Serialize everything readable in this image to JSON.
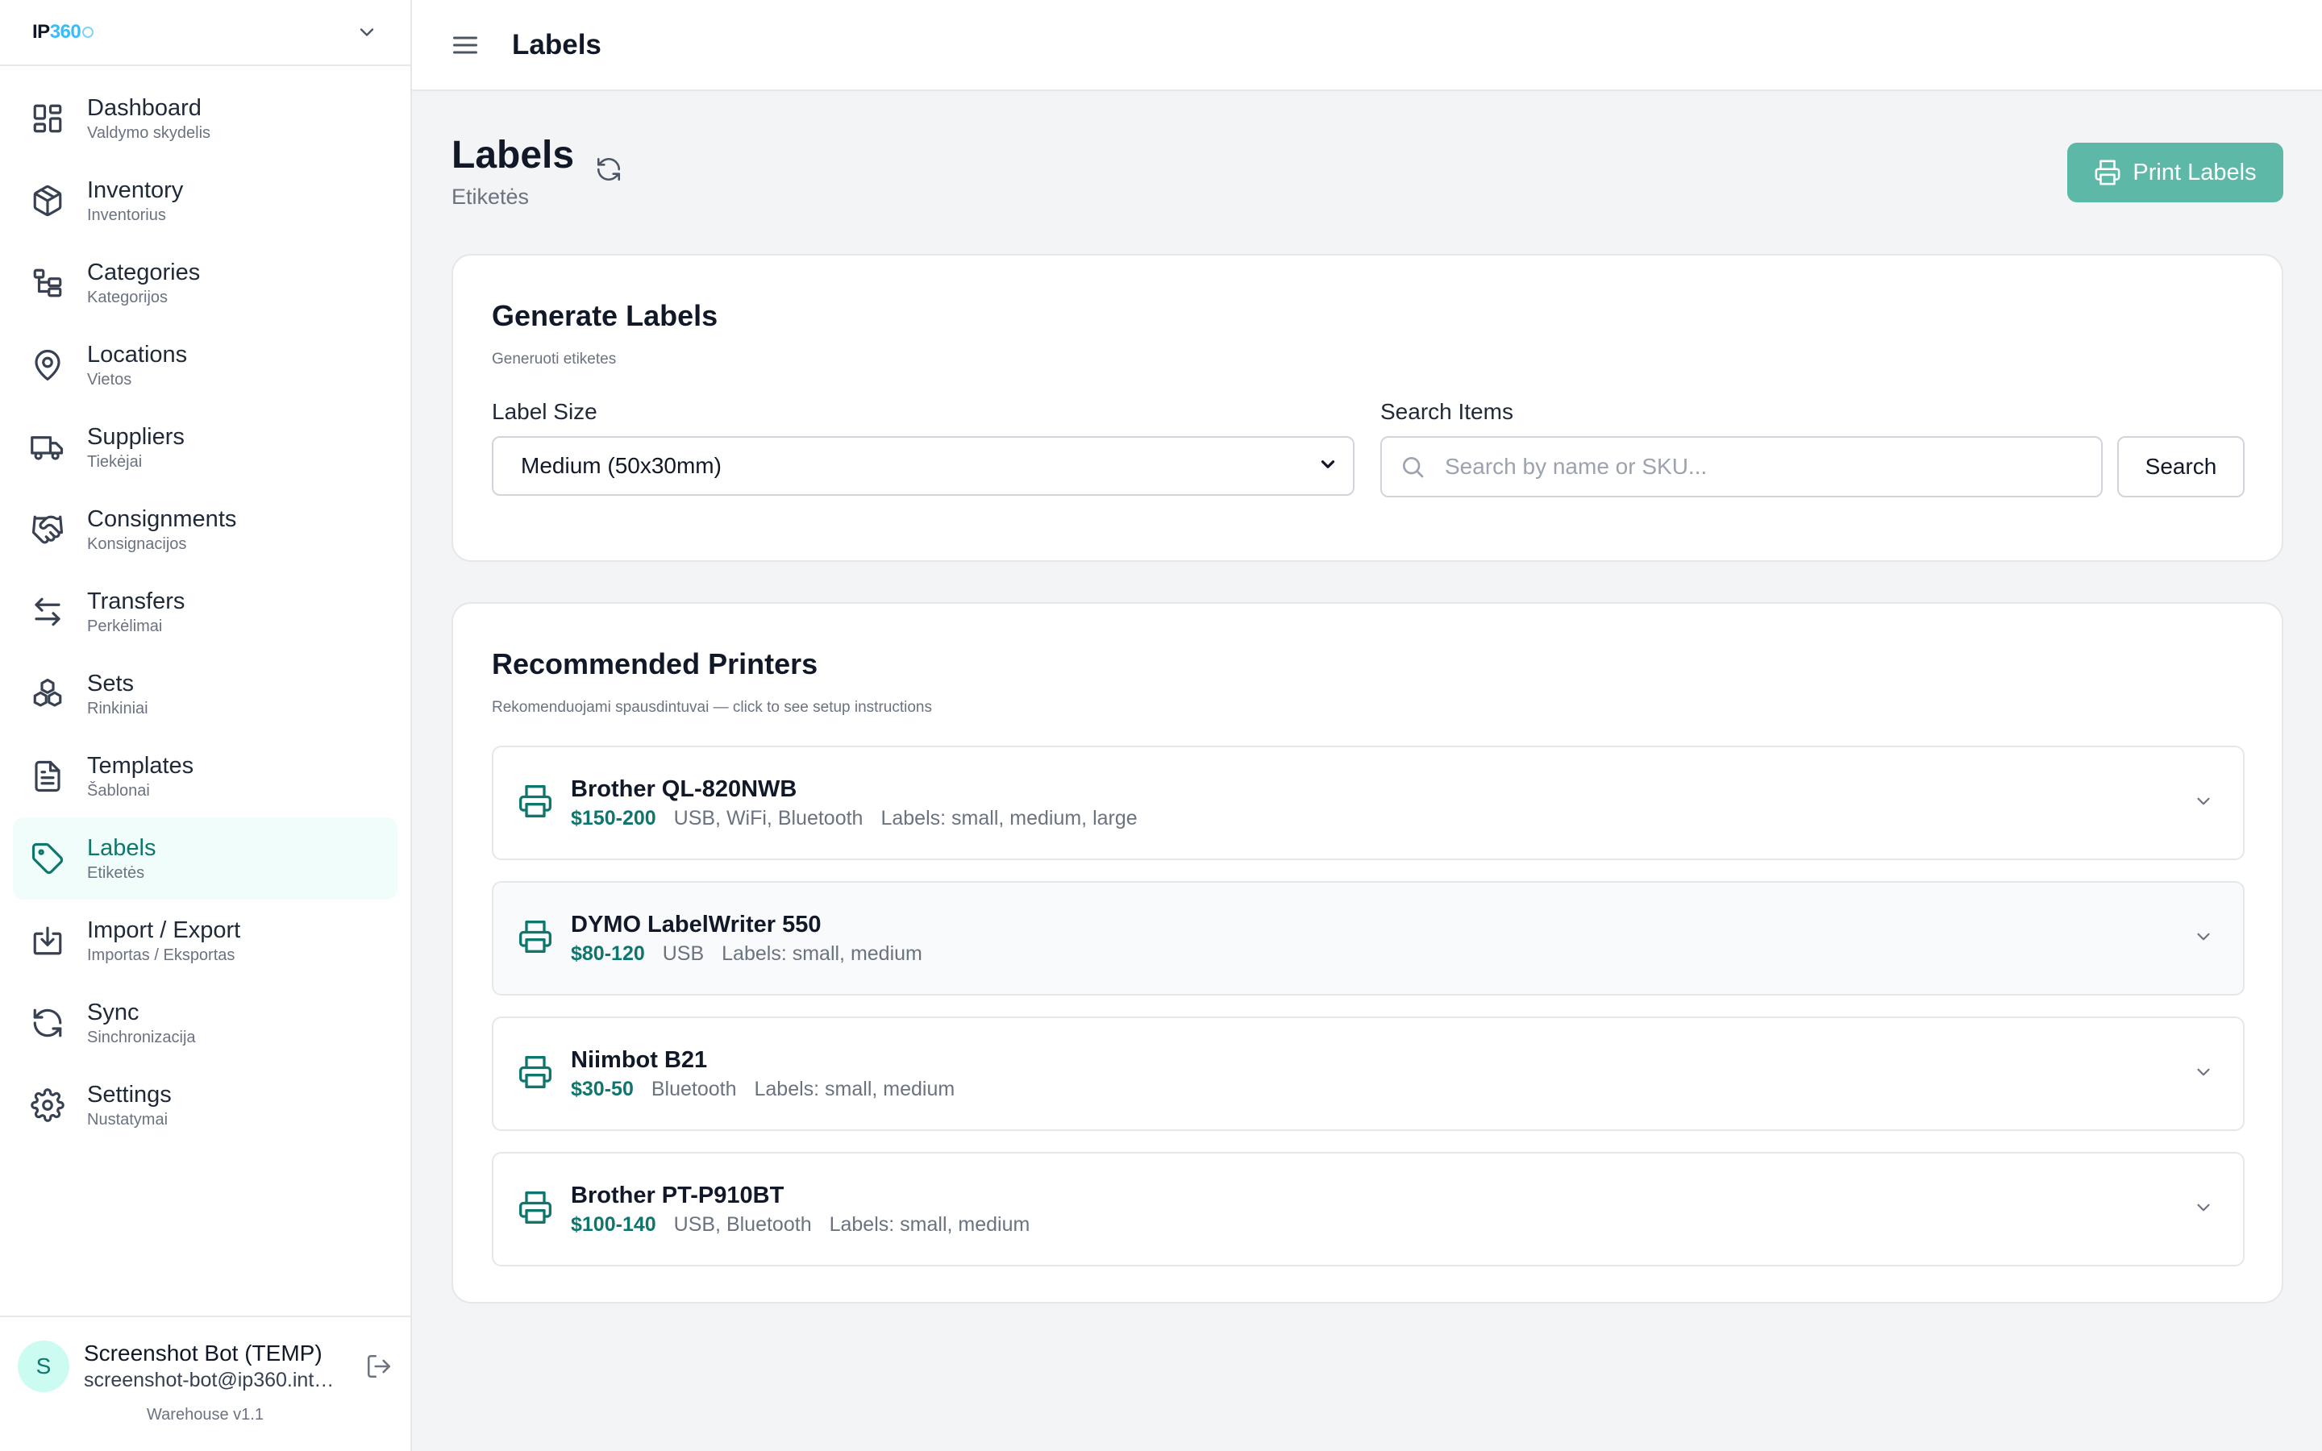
{
  "brand": {
    "name_a": "IP",
    "name_b": "360"
  },
  "sidebar": {
    "items": [
      {
        "label": "Dashboard",
        "sub": "Valdymo skydelis",
        "icon": "dashboard-icon"
      },
      {
        "label": "Inventory",
        "sub": "Inventorius",
        "icon": "box-icon"
      },
      {
        "label": "Categories",
        "sub": "Kategorijos",
        "icon": "folder-tree-icon"
      },
      {
        "label": "Locations",
        "sub": "Vietos",
        "icon": "map-pin-icon"
      },
      {
        "label": "Suppliers",
        "sub": "Tiekėjai",
        "icon": "truck-icon"
      },
      {
        "label": "Consignments",
        "sub": "Konsignacijos",
        "icon": "handshake-icon"
      },
      {
        "label": "Transfers",
        "sub": "Perkėlimai",
        "icon": "arrows-exchange-icon"
      },
      {
        "label": "Sets",
        "sub": "Rinkiniai",
        "icon": "boxes-icon"
      },
      {
        "label": "Templates",
        "sub": "Šablonai",
        "icon": "document-icon"
      },
      {
        "label": "Labels",
        "sub": "Etiketės",
        "icon": "tag-icon",
        "active": true
      },
      {
        "label": "Import / Export",
        "sub": "Importas / Eksportas",
        "icon": "import-icon"
      },
      {
        "label": "Sync",
        "sub": "Sinchronizacija",
        "icon": "sync-icon"
      },
      {
        "label": "Settings",
        "sub": "Nustatymai",
        "icon": "gear-icon"
      }
    ]
  },
  "user": {
    "initial": "S",
    "name": "Screenshot Bot (TEMP)",
    "email": "screenshot-bot@ip360.internal",
    "version": "Warehouse v1.1"
  },
  "topbar": {
    "title": "Labels"
  },
  "page": {
    "title": "Labels",
    "subtitle": "Etiketės",
    "print_button": "Print Labels"
  },
  "generate": {
    "title": "Generate Labels",
    "subtitle": "Generuoti etiketes",
    "label_size_label": "Label Size",
    "label_size_value": "Medium (50x30mm)",
    "search_label": "Search Items",
    "search_placeholder": "Search by name or SKU...",
    "search_button": "Search"
  },
  "printers": {
    "title": "Recommended Printers",
    "subtitle": "Rekomenduojami spausdintuvai — click to see setup instructions",
    "items": [
      {
        "name": "Brother QL-820NWB",
        "price": "$150-200",
        "connectivity": "USB, WiFi, Bluetooth",
        "labels": "Labels: small, medium, large"
      },
      {
        "name": "DYMO LabelWriter 550",
        "price": "$80-120",
        "connectivity": "USB",
        "labels": "Labels: small, medium"
      },
      {
        "name": "Niimbot B21",
        "price": "$30-50",
        "connectivity": "Bluetooth",
        "labels": "Labels: small, medium"
      },
      {
        "name": "Brother PT-P910BT",
        "price": "$100-140",
        "connectivity": "USB, Bluetooth",
        "labels": "Labels: small, medium"
      }
    ]
  },
  "colors": {
    "accent": "#0f766e",
    "accent_button": "#5eb8a8",
    "active_bg": "#f0fdfa"
  }
}
